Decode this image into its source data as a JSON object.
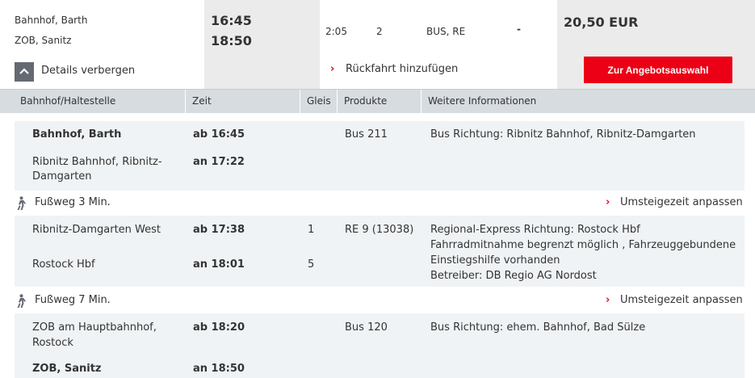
{
  "summary": {
    "from_station": "Bahnhof, Barth",
    "to_station": "ZOB, Sanitz",
    "dep_time": "16:45",
    "arr_time": "18:50",
    "duration": "2:05",
    "changes": "2",
    "products": "BUS, RE",
    "extra": "-",
    "price": "20,50 EUR",
    "details_label": "Details verbergen",
    "return_label": "Rückfahrt hinzufügen",
    "offer_button": "Zur Angebotsauswahl"
  },
  "table": {
    "headers": [
      "Bahnhof/Haltestelle",
      "Zeit",
      "Gleis",
      "Produkte",
      "Weitere Informationen"
    ]
  },
  "legs": [
    {
      "dep_station": "Bahnhof, Barth",
      "dep_time": "ab 16:45",
      "arr_station_line1": "Ribnitz Bahnhof, Ribnitz-",
      "arr_station_line2": "Damgarten",
      "arr_time": "an 17:22",
      "dep_track": "",
      "arr_track": "",
      "product": "Bus 211",
      "info": [
        "Bus Richtung: Ribnitz Bahnhof, Ribnitz-Damgarten"
      ]
    },
    {
      "dep_station": "Ribnitz-Damgarten West",
      "dep_time": "ab 17:38",
      "arr_station_line1": "Rostock Hbf",
      "arr_station_line2": "",
      "arr_time": "an 18:01",
      "dep_track": "1",
      "arr_track": "5",
      "product": "RE 9 (13038)",
      "info": [
        "Regional-Express Richtung: Rostock Hbf",
        "Fahrradmitnahme begrenzt möglich , Fahrzeuggebundene",
        "Einstiegshilfe vorhanden",
        "Betreiber: DB Regio AG Nordost"
      ]
    },
    {
      "dep_station_line1": "ZOB am Hauptbahnhof,",
      "dep_station_line2": "Rostock",
      "dep_time": "ab 18:20",
      "arr_station": "ZOB, Sanitz",
      "arr_time": "an 18:50",
      "product": "Bus 120",
      "info": [
        "Bus Richtung: ehem. Bahnhof, Bad Sülze"
      ]
    }
  ],
  "walks": [
    {
      "label": "Fußweg 3 Min.",
      "action": "Umsteigezeit anpassen"
    },
    {
      "label": "Fußweg 7 Min.",
      "action": "Umsteigezeit anpassen"
    }
  ],
  "icons": {
    "toggle": "chevron-up-icon",
    "walk": "pedestrian-icon",
    "link": "chevron-right-icon"
  },
  "colors": {
    "accent_red": "#ec0016",
    "header_bg": "#d7dce1",
    "segment_bg": "#f0f3f5",
    "summary_gray": "#ebebeb"
  }
}
